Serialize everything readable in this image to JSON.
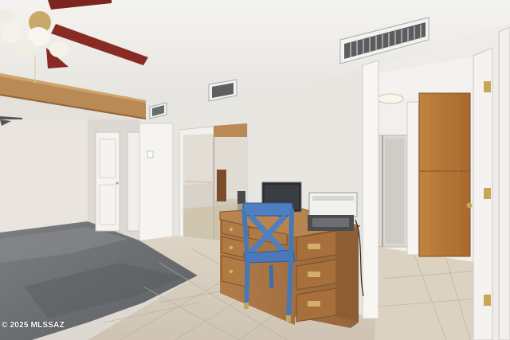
{
  "photo": {
    "watermark": "© 2025 MLSSAZ",
    "palette": {
      "wall": "#e8e6e1",
      "ceiling": "#efeeea",
      "floor_tile": "#d8cfc0",
      "carpet": "#6f7276",
      "beam": "#b98a55",
      "door_wood": "#b97a3a",
      "dresser": "#a87443",
      "chair_blue": "#4f7fc0",
      "fan_blade": "#8a2a24",
      "trim_white": "#f6f5f2"
    }
  }
}
